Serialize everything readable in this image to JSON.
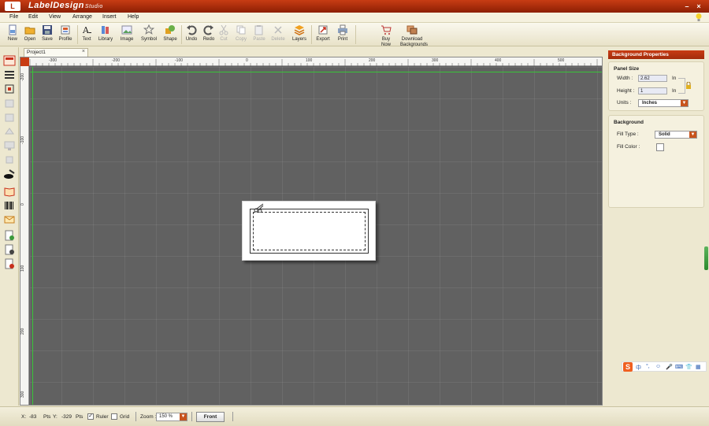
{
  "title": {
    "logo": "L",
    "app_name": "LabelDesign",
    "app_sub": "Studio",
    "minimize": "–",
    "close": "×"
  },
  "menu": [
    "File",
    "Edit",
    "View",
    "Arrange",
    "Insert",
    "Help"
  ],
  "toolbar": {
    "new": "New",
    "open": "Open",
    "save": "Save",
    "profile": "Profile",
    "text": "Text",
    "library": "Library",
    "image": "Image",
    "symbol": "Symbol",
    "shape": "Shape",
    "undo": "Undo",
    "redo": "Redo",
    "cut": "Cut",
    "copy": "Copy",
    "paste": "Paste",
    "delete": "Delete",
    "layers": "Layers",
    "export": "Export",
    "print": "Print",
    "buy_now_1": "Buy",
    "buy_now_2": "Now",
    "download_1": "Download",
    "download_2": "Backgrounds"
  },
  "document": {
    "tab_name": "Project1",
    "tab_close": "×"
  },
  "ruler": {
    "h_labels": [
      "-300",
      "-200",
      "-100",
      "0",
      "100",
      "200",
      "300",
      "400",
      "500"
    ],
    "v_labels": [
      "-200",
      "-100",
      "0",
      "100",
      "200",
      "300"
    ]
  },
  "properties": {
    "header": "Background Properties",
    "panel_size": {
      "title": "Panel Size",
      "width_label": "Width :",
      "width_value": "2.62",
      "width_unit": "In",
      "height_label": "Height :",
      "height_value": "1",
      "height_unit": "In",
      "units_label": "Units :",
      "units_value": "Inches"
    },
    "background": {
      "title": "Background",
      "fill_type_label": "Fill Type :",
      "fill_type_value": "Solid",
      "fill_color_label": "Fill Color :",
      "fill_color_value": "#ffffff"
    }
  },
  "ime": {
    "logo": "S",
    "items": [
      "中",
      "°,",
      "☺",
      "🎤",
      "⌨",
      "👕",
      "▦"
    ]
  },
  "status": {
    "x_label": "X:",
    "x_value": "-83",
    "x_unit": "Pts",
    "y_label": "Y:",
    "y_value": "-329",
    "y_unit": "Pts",
    "ruler_label": "Ruler",
    "ruler_checked": "✓",
    "grid_label": "Grid",
    "zoom_label": "Zoom :",
    "zoom_value": "150 %",
    "front_button": "Front"
  },
  "colors": {
    "accent": "#b32e0a",
    "canvas": "#616161",
    "guide": "#39c439"
  }
}
